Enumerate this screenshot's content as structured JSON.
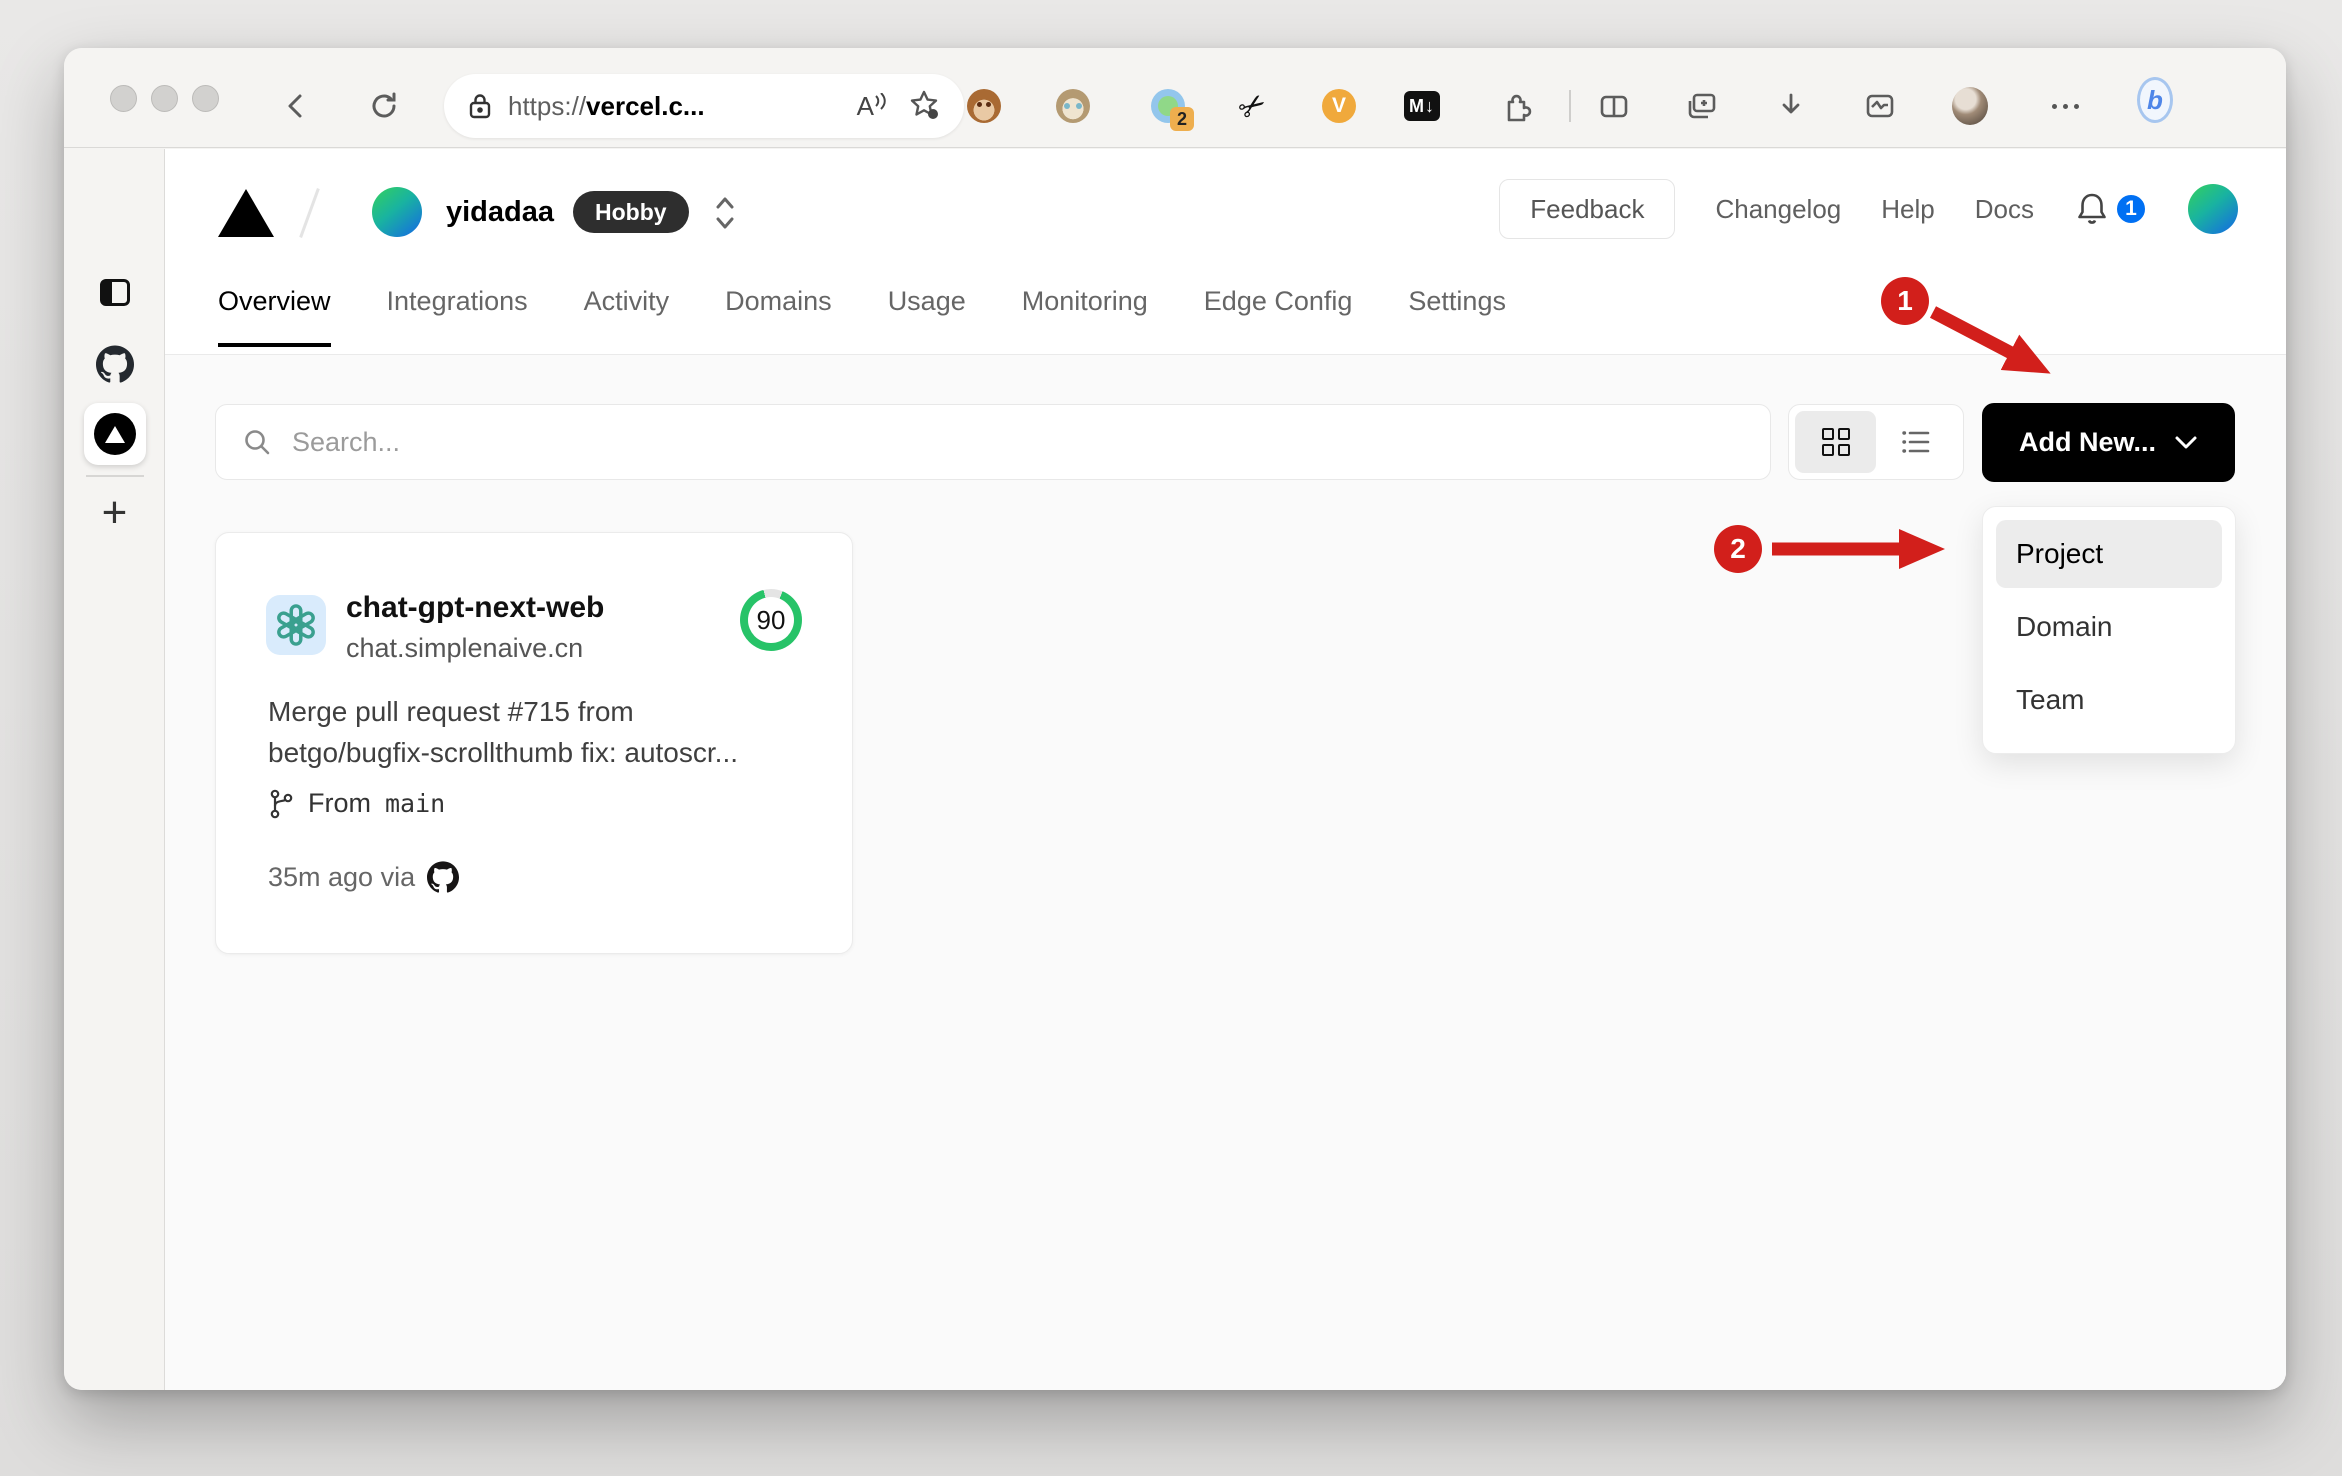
{
  "address_bar": {
    "scheme": "https://",
    "domain": "vercel.c...",
    "read_aloud_label": "A"
  },
  "browser_toolbar": {
    "extension_badge": "2",
    "scissors_glyph": "✂",
    "v_extension_letter": "V",
    "markdown_extension_label": "M↓",
    "bing_letter": "b"
  },
  "vercel_header": {
    "team_name": "yidadaa",
    "plan_badge": "Hobby",
    "feedback_button": "Feedback",
    "changelog_link": "Changelog",
    "help_link": "Help",
    "docs_link": "Docs",
    "notification_count": "1"
  },
  "tabs": [
    {
      "label": "Overview",
      "active": true
    },
    {
      "label": "Integrations",
      "active": false
    },
    {
      "label": "Activity",
      "active": false
    },
    {
      "label": "Domains",
      "active": false
    },
    {
      "label": "Usage",
      "active": false
    },
    {
      "label": "Monitoring",
      "active": false
    },
    {
      "label": "Edge Config",
      "active": false
    },
    {
      "label": "Settings",
      "active": false
    }
  ],
  "controls": {
    "search_placeholder": "Search...",
    "add_new_button": "Add New..."
  },
  "add_new_menu": {
    "items": [
      {
        "label": "Project",
        "highlighted": true
      },
      {
        "label": "Domain",
        "highlighted": false
      },
      {
        "label": "Team",
        "highlighted": false
      }
    ]
  },
  "project_card": {
    "name": "chat-gpt-next-web",
    "domain": "chat.simplenaive.cn",
    "score": "90",
    "commit_line1": "Merge pull request #715 from",
    "commit_line2": "betgo/bugfix-scrollthumb fix: autoscr...",
    "branch_label": "From",
    "branch_name": "main",
    "deploy_meta": "35m ago via"
  },
  "annotations": {
    "step1": "1",
    "step2": "2"
  },
  "colors": {
    "annotation_red": "#d21f1b",
    "score_green": "#27c368",
    "notification_blue": "#0070f3",
    "button_black": "#000000"
  }
}
